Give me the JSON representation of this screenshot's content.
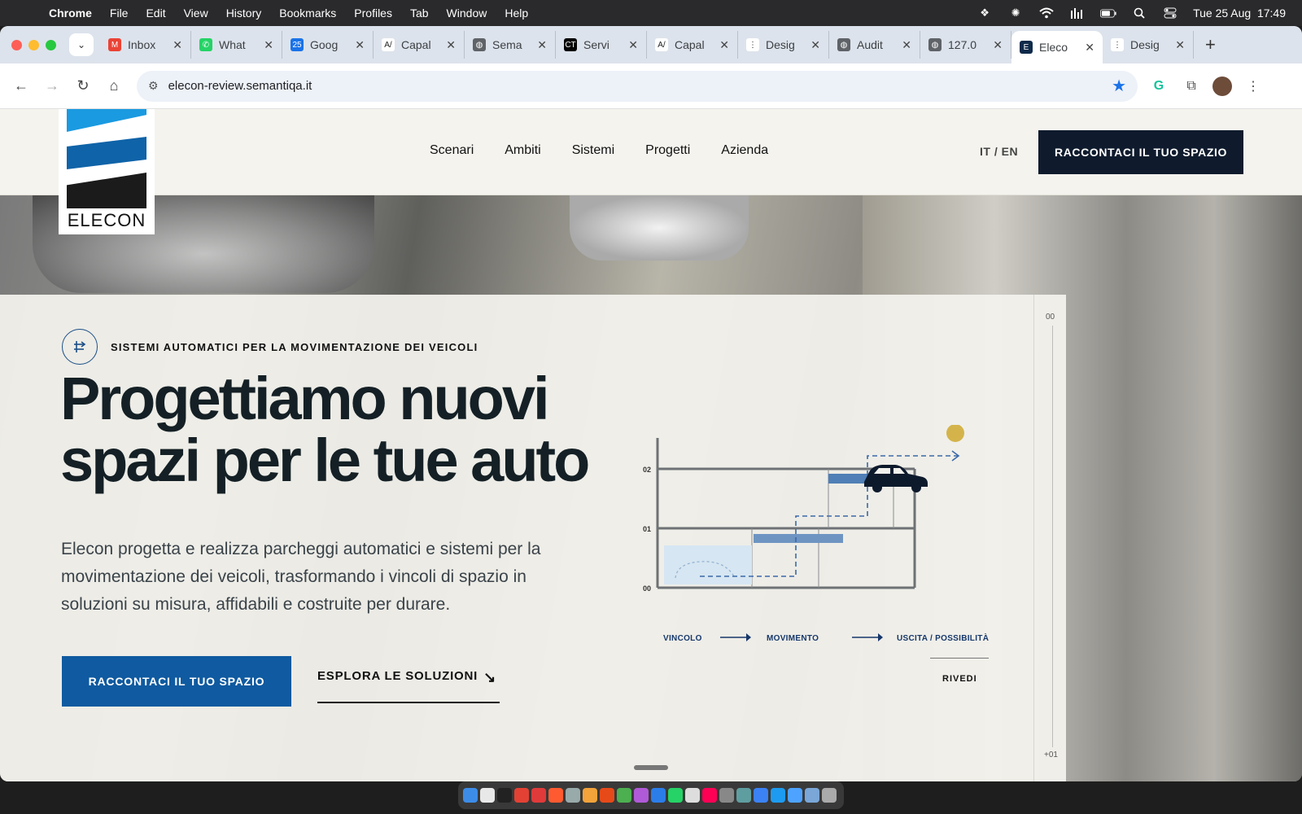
{
  "menubar": {
    "app": "Chrome",
    "items": [
      "File",
      "Edit",
      "View",
      "History",
      "Bookmarks",
      "Profiles",
      "Tab",
      "Window",
      "Help"
    ],
    "clock": "Tue 25 Aug  17:49"
  },
  "tabs": [
    {
      "label": "Inbox",
      "icon": "gmail-icon",
      "color": "#ea4335",
      "glyph": "M"
    },
    {
      "label": "What",
      "icon": "whatsapp-icon",
      "color": "#25d366",
      "glyph": "✆"
    },
    {
      "label": "Goog",
      "icon": "google-calendar-icon",
      "color": "#1a73e8",
      "glyph": "25"
    },
    {
      "label": "Capal",
      "icon": "capacities-icon",
      "color": "#ffffff",
      "glyph": "A/"
    },
    {
      "label": "Sema",
      "icon": "globe-icon",
      "color": "#5f6368",
      "glyph": "◍"
    },
    {
      "label": "Servi",
      "icon": "service-icon",
      "color": "#000000",
      "glyph": "CT"
    },
    {
      "label": "Capal",
      "icon": "capacities-icon",
      "color": "#ffffff",
      "glyph": "A/"
    },
    {
      "label": "Desig",
      "icon": "dots-icon",
      "color": "#ffffff",
      "glyph": "⋮"
    },
    {
      "label": "Audit",
      "icon": "globe-icon",
      "color": "#5f6368",
      "glyph": "◍"
    },
    {
      "label": "127.0",
      "icon": "globe-icon",
      "color": "#5f6368",
      "glyph": "◍"
    },
    {
      "label": "Eleco",
      "icon": "elecon-icon",
      "color": "#0f2a4a",
      "glyph": "E",
      "active": true
    },
    {
      "label": "Desig",
      "icon": "dots-icon",
      "color": "#ffffff",
      "glyph": "⋮"
    }
  ],
  "omnibox": {
    "url": "elecon-review.semantiqa.it"
  },
  "site": {
    "logo_text": "ELECON",
    "nav": [
      "Scenari",
      "Ambiti",
      "Sistemi",
      "Progetti",
      "Azienda"
    ],
    "lang": "IT / EN",
    "cta_top": "RACCONTACI IL TUO SPAZIO"
  },
  "hero": {
    "badge": "SISTEMI AUTOMATICI PER LA MOVIMENTAZIONE DEI VEICOLI",
    "title_line1": "Progettiamo nuovi",
    "title_line2": "spazi per le tue auto",
    "lead": "Elecon progetta e realizza parcheggi automatici e sistemi per la movimentazione dei veicoli, trasformando i vincoli di spazio in soluzioni su misura, affidabili e costruite per durare.",
    "cta_primary": "RACCONTACI IL TUO SPAZIO",
    "cta_secondary": "ESPLORA LE SOLUZIONI",
    "cta_secondary_arrow": "↘"
  },
  "diagram": {
    "levels": [
      "02",
      "01",
      "00"
    ],
    "flow": [
      "VINCOLO",
      "MOVIMENTO",
      "USCITA / POSSIBILITÀ"
    ],
    "replay": "RIVEDI"
  },
  "scrubber": {
    "top": "00",
    "bottom": "+01"
  }
}
